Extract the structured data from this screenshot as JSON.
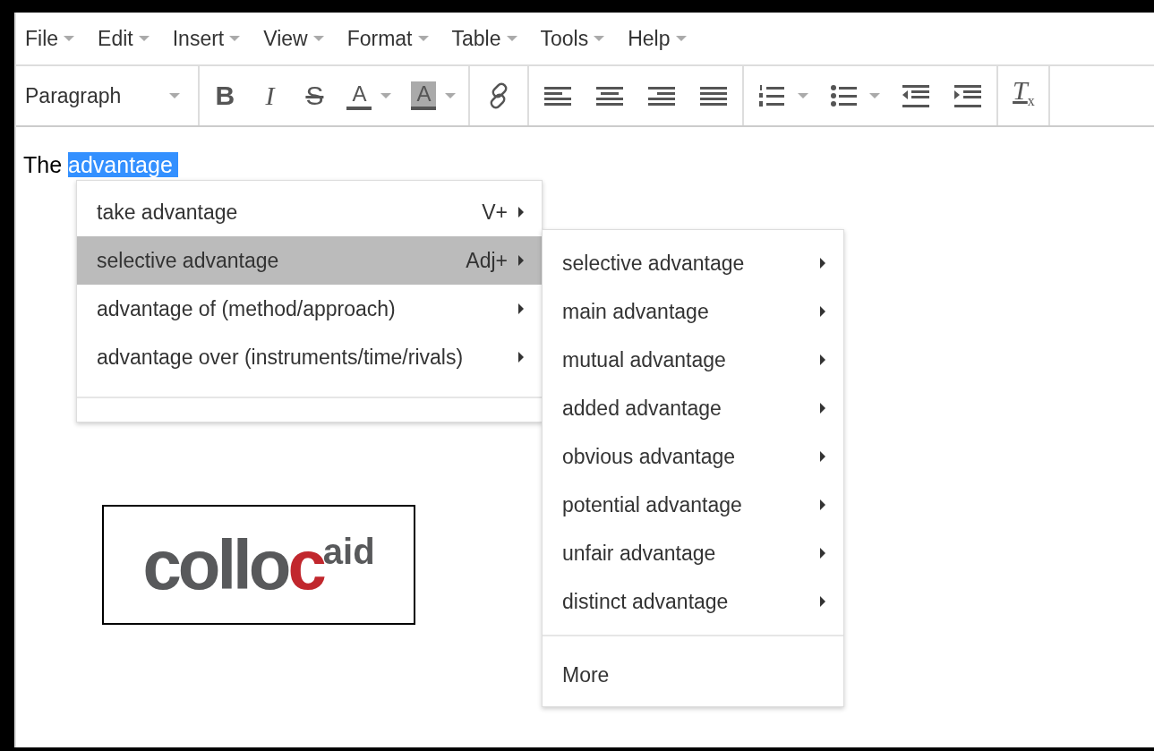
{
  "menubar": [
    {
      "label": "File"
    },
    {
      "label": "Edit"
    },
    {
      "label": "Insert"
    },
    {
      "label": "View"
    },
    {
      "label": "Format"
    },
    {
      "label": "Table"
    },
    {
      "label": "Tools"
    },
    {
      "label": "Help"
    }
  ],
  "toolbar": {
    "block_format": "Paragraph",
    "groups": [
      [
        {
          "kind": "bold",
          "text": "B"
        },
        {
          "kind": "italic",
          "text": "I"
        },
        {
          "kind": "strike",
          "text": "S"
        },
        {
          "kind": "forecolor",
          "text": "A"
        },
        {
          "kind": "backcolor",
          "text": "A"
        }
      ],
      [
        {
          "kind": "link"
        }
      ],
      [
        {
          "kind": "align-left"
        },
        {
          "kind": "align-center"
        },
        {
          "kind": "align-right"
        },
        {
          "kind": "justify"
        }
      ],
      [
        {
          "kind": "numbered-list"
        },
        {
          "kind": "bullet-list"
        },
        {
          "kind": "outdent"
        },
        {
          "kind": "indent"
        }
      ],
      [
        {
          "kind": "clear-format",
          "text": "T",
          "sub": "x"
        }
      ]
    ]
  },
  "document": {
    "before": "The ",
    "selected_text": "advantage",
    "logo": {
      "main": "collo",
      "accent": "c",
      "suffix": "aid"
    }
  },
  "context_menu": {
    "items": [
      {
        "label": "take advantage",
        "shortcut": "V+",
        "selected": false
      },
      {
        "label": "selective advantage",
        "shortcut": "Adj+",
        "selected": true
      },
      {
        "label": "advantage of (method/approach)",
        "selected": false
      },
      {
        "label": "advantage over (instruments/time/rivals)",
        "selected": false
      }
    ]
  },
  "submenu": {
    "items": [
      {
        "label": "selective advantage"
      },
      {
        "label": "main advantage"
      },
      {
        "label": "mutual advantage"
      },
      {
        "label": "added advantage"
      },
      {
        "label": "obvious advantage"
      },
      {
        "label": "potential advantage"
      },
      {
        "label": "unfair advantage"
      },
      {
        "label": "distinct advantage"
      }
    ],
    "more": "More"
  }
}
